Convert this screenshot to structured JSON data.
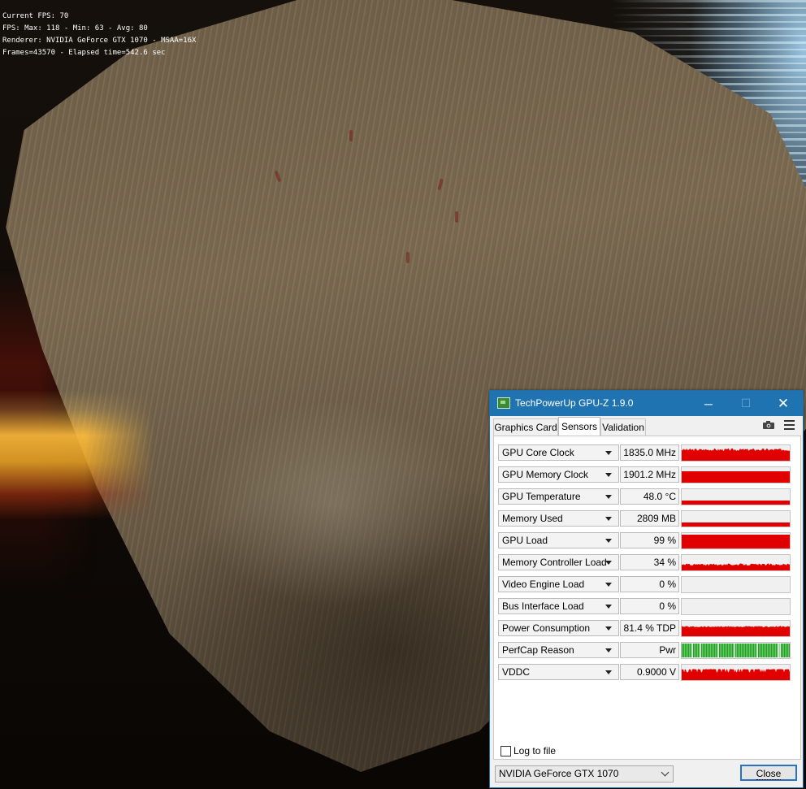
{
  "overlay": {
    "line1": "Current FPS: 70",
    "line2": "FPS: Max: 118 - Min: 63 - Avg: 80",
    "line3": "Renderer: NVIDIA GeForce GTX 1070 - MSAA=16X",
    "line4": "Frames=43570 - Elapsed time=542.6 sec"
  },
  "window": {
    "title": "TechPowerUp GPU-Z 1.9.0",
    "minimize": "─",
    "maximize": "☐",
    "close": "✕"
  },
  "tabs": {
    "graphics_card": "Graphics Card",
    "sensors": "Sensors",
    "validation": "Validation"
  },
  "sensors": [
    {
      "name": "GPU Core Clock",
      "value": "1835.0 MHz",
      "graph": "red-noisy-high"
    },
    {
      "name": "GPU Memory Clock",
      "value": "1901.2 MHz",
      "graph": "red-flat-high"
    },
    {
      "name": "GPU Temperature",
      "value": "48.0 °C",
      "graph": "red-low"
    },
    {
      "name": "Memory Used",
      "value": "2809 MB",
      "graph": "red-low"
    },
    {
      "name": "GPU Load",
      "value": "99 %",
      "graph": "red-full"
    },
    {
      "name": "Memory Controller Load",
      "value": "34 %",
      "graph": "red-mid-noisy"
    },
    {
      "name": "Video Engine Load",
      "value": "0 %",
      "graph": "empty"
    },
    {
      "name": "Bus Interface Load",
      "value": "0 %",
      "graph": "empty"
    },
    {
      "name": "Power Consumption",
      "value": "81.4 % TDP",
      "graph": "red-mid-high"
    },
    {
      "name": "PerfCap Reason",
      "value": "Pwr",
      "graph": "green-bars"
    },
    {
      "name": "VDDC",
      "value": "0.9000 V",
      "graph": "red-spiky"
    }
  ],
  "footer": {
    "log_to_file": "Log to file",
    "gpu_selected": "NVIDIA GeForce GTX 1070",
    "close_label": "Close"
  },
  "colors": {
    "titlebar": "#1e73b0",
    "graph_red": "#e00000",
    "graph_green": "#1aa51a"
  },
  "icons": {
    "camera": "camera-icon",
    "menu": "hamburger-menu-icon",
    "app": "gpu-z-app-icon"
  }
}
